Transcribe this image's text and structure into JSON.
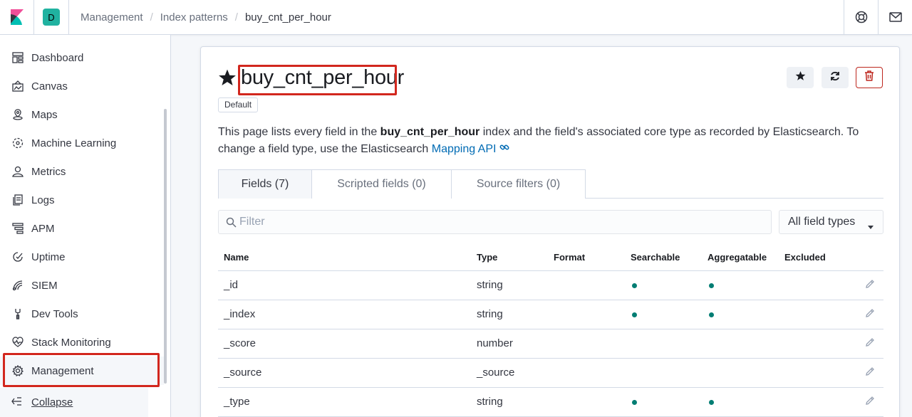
{
  "breadcrumbs": [
    "Management",
    "Index patterns",
    "buy_cnt_per_hour"
  ],
  "space_initial": "D",
  "nav": {
    "items": [
      {
        "label": "Dashboard",
        "icon": "dashboard-icon"
      },
      {
        "label": "Canvas",
        "icon": "canvas-icon"
      },
      {
        "label": "Maps",
        "icon": "maps-icon"
      },
      {
        "label": "Machine Learning",
        "icon": "machine-learning-icon"
      },
      {
        "label": "Metrics",
        "icon": "metrics-icon"
      },
      {
        "label": "Logs",
        "icon": "logs-icon"
      },
      {
        "label": "APM",
        "icon": "apm-icon"
      },
      {
        "label": "Uptime",
        "icon": "uptime-icon"
      },
      {
        "label": "SIEM",
        "icon": "siem-icon"
      },
      {
        "label": "Dev Tools",
        "icon": "dev-tools-icon"
      },
      {
        "label": "Stack Monitoring",
        "icon": "stack-monitoring-icon"
      },
      {
        "label": "Management",
        "icon": "gear-icon"
      }
    ],
    "active": "Management",
    "collapse_label": "Collapse"
  },
  "page": {
    "title": "buy_cnt_per_hour",
    "badge": "Default",
    "desc_pre": "This page lists every field in the ",
    "desc_bold": "buy_cnt_per_hour",
    "desc_post": " index and the field's associated core type as recorded by Elasticsearch. To change a field type, use the Elasticsearch ",
    "desc_link": "Mapping API"
  },
  "tabs": [
    "Fields (7)",
    "Scripted fields (0)",
    "Source filters (0)"
  ],
  "filter": {
    "placeholder": "Filter"
  },
  "type_select": {
    "value": "All field types"
  },
  "table": {
    "headers": [
      "Name",
      "Type",
      "Format",
      "Searchable",
      "Aggregatable",
      "Excluded"
    ],
    "rows": [
      {
        "name": "_id",
        "type": "string",
        "format": "",
        "searchable": true,
        "aggregatable": true,
        "excluded": false
      },
      {
        "name": "_index",
        "type": "string",
        "format": "",
        "searchable": true,
        "aggregatable": true,
        "excluded": false
      },
      {
        "name": "_score",
        "type": "number",
        "format": "",
        "searchable": false,
        "aggregatable": false,
        "excluded": false
      },
      {
        "name": "_source",
        "type": "_source",
        "format": "",
        "searchable": false,
        "aggregatable": false,
        "excluded": false
      },
      {
        "name": "_type",
        "type": "string",
        "format": "",
        "searchable": true,
        "aggregatable": true,
        "excluded": false
      }
    ]
  },
  "colors": {
    "accent": "#006bb4",
    "highlight": "#d2271e",
    "dot": "#017d73",
    "space": "#20b2a0"
  }
}
